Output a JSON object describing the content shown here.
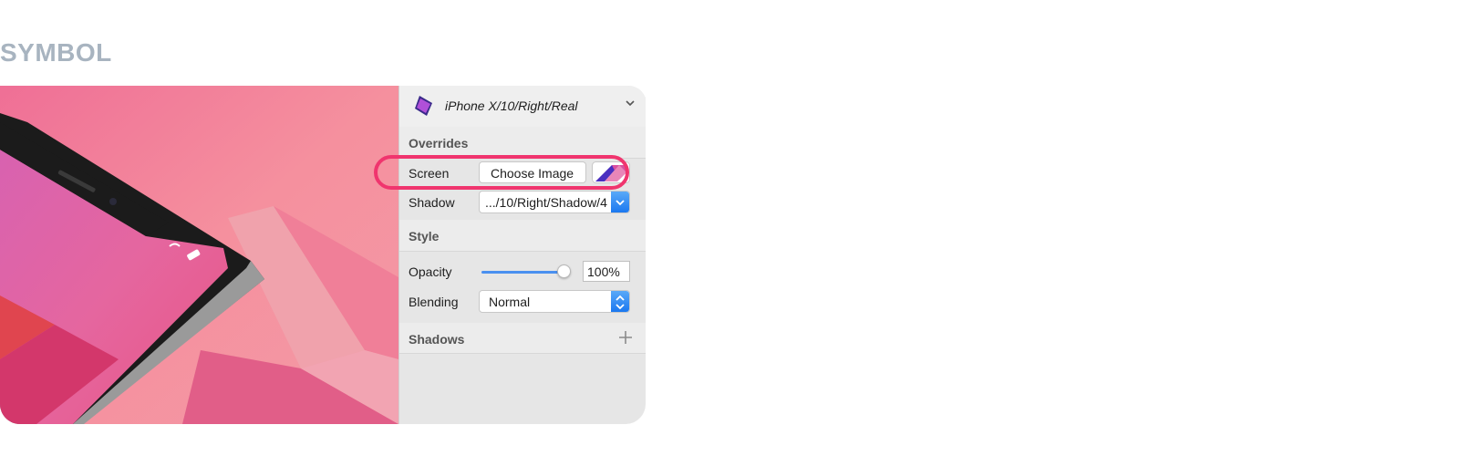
{
  "heading": "SYMBOL",
  "symbol": {
    "name": "iPhone X/10/Right/Real",
    "icon": "phone-thumbnail-icon"
  },
  "overrides": {
    "title": "Overrides",
    "screen_label": "Screen",
    "choose_image_label": "Choose Image",
    "shadow_label": "Shadow",
    "shadow_value": ".../10/Right/Shadow/4"
  },
  "style": {
    "title": "Style",
    "opacity_label": "Opacity",
    "opacity_value": "100%",
    "opacity_level": 1.0,
    "blending_label": "Blending",
    "blending_value": "Normal"
  },
  "shadows": {
    "title": "Shadows"
  },
  "colors": {
    "highlight": "#f0356e",
    "accent": "#1b78f0"
  }
}
